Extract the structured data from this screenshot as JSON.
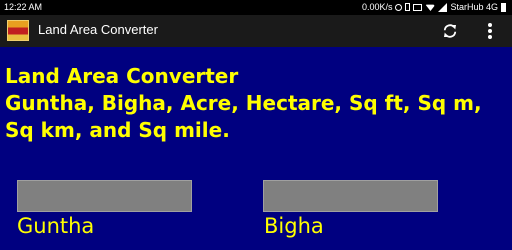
{
  "status_bar": {
    "time": "12:22 AM",
    "network_speed": "0.00K/s",
    "carrier": "StarHub 4G"
  },
  "action_bar": {
    "title": "Land Area Converter",
    "icons": [
      "refresh-icon",
      "overflow-menu-icon"
    ]
  },
  "main": {
    "heading_line1": "Land Area Converter",
    "heading_line2": "Guntha, Bigha, Acre, Hectare, Sq ft, Sq m, Sq km, and Sq mile."
  },
  "converter": {
    "guntha_label": "Guntha",
    "guntha_value": "",
    "bigha_label": "Bigha",
    "bigha_value": ""
  },
  "colors": {
    "background": "#000080",
    "text_accent": "#ffff00",
    "field_bg": "#808080"
  }
}
